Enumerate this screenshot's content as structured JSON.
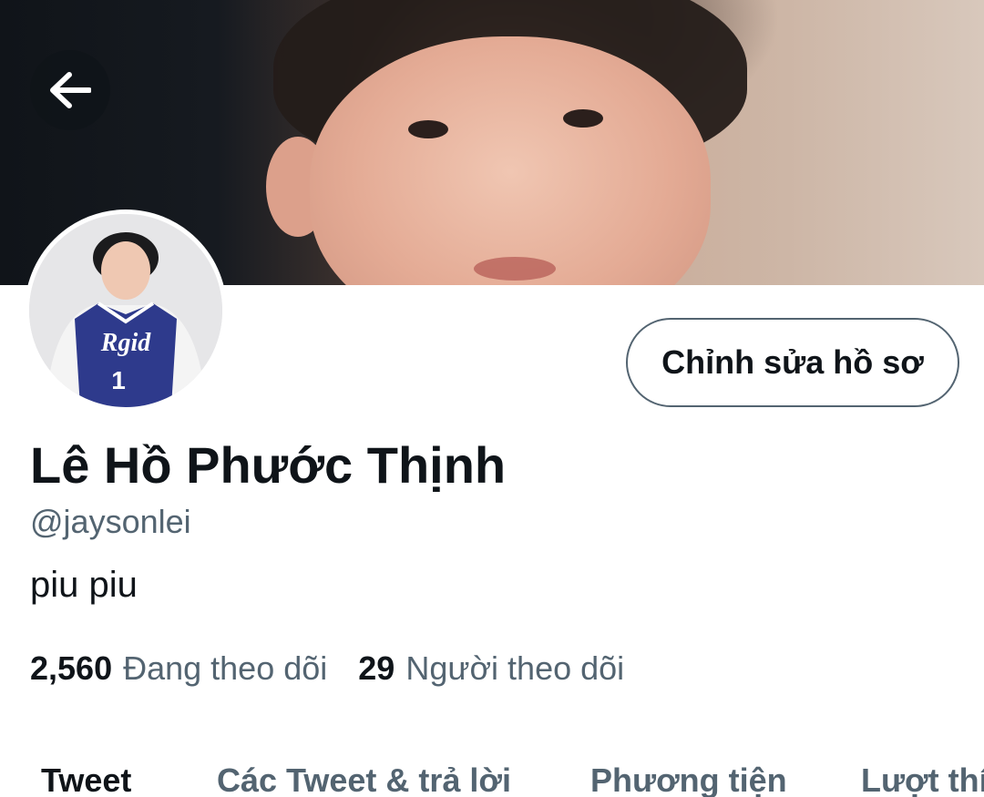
{
  "header": {
    "back_icon": "arrow-left-icon"
  },
  "profile": {
    "name": "Lê Hồ Phước Thịnh",
    "handle": "@jaysonlei",
    "bio": "piu piu",
    "edit_label": "Chỉnh sửa hồ sơ",
    "avatar_jersey_text": "Rgid",
    "avatar_jersey_number": "1"
  },
  "stats": {
    "following_count": "2,560",
    "following_label": "Đang theo dõi",
    "followers_count": "29",
    "followers_label": "Người theo dõi"
  },
  "tabs": [
    {
      "label": "Tweet",
      "active": true
    },
    {
      "label": "Các Tweet & trả lời",
      "active": false
    },
    {
      "label": "Phương tiện",
      "active": false
    },
    {
      "label": "Lượt thích",
      "active": false
    }
  ],
  "colors": {
    "text_primary": "#0f1419",
    "text_secondary": "#536471",
    "border": "#536471",
    "back_button_bg": "#0f1419"
  }
}
